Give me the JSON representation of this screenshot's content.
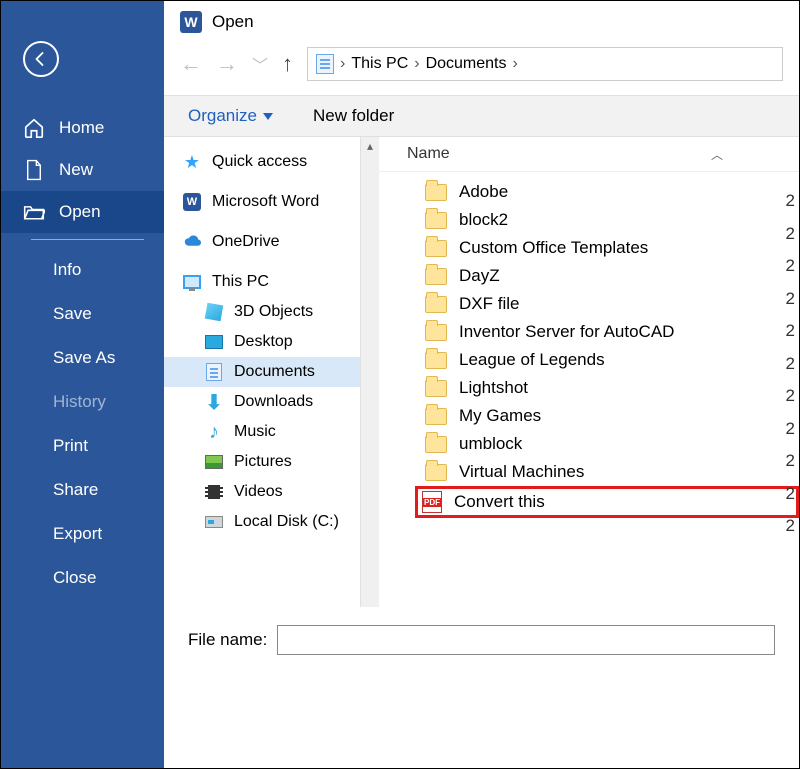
{
  "word_sidebar": {
    "back_label": "Back",
    "primary": [
      {
        "icon": "home",
        "label": "Home"
      },
      {
        "icon": "new",
        "label": "New"
      },
      {
        "icon": "open",
        "label": "Open",
        "selected": true
      }
    ],
    "secondary": [
      {
        "label": "Info"
      },
      {
        "label": "Save"
      },
      {
        "label": "Save As"
      },
      {
        "label": "History",
        "dim": true
      },
      {
        "label": "Print"
      },
      {
        "label": "Share"
      },
      {
        "label": "Export"
      },
      {
        "label": "Close"
      }
    ]
  },
  "dialog": {
    "title": "Open",
    "breadcrumb": [
      "This PC",
      "Documents"
    ],
    "toolbar": {
      "organize": "Organize",
      "newfolder": "New folder"
    },
    "nav_items": [
      {
        "type": "quickaccess",
        "label": "Quick access"
      },
      {
        "type": "word",
        "label": "Microsoft Word"
      },
      {
        "type": "onedrive",
        "label": "OneDrive"
      },
      {
        "type": "thispc",
        "label": "This PC"
      },
      {
        "type": "3dobjects",
        "label": "3D Objects",
        "child": true
      },
      {
        "type": "desktop",
        "label": "Desktop",
        "child": true
      },
      {
        "type": "documents",
        "label": "Documents",
        "child": true,
        "selected": true
      },
      {
        "type": "downloads",
        "label": "Downloads",
        "child": true
      },
      {
        "type": "music",
        "label": "Music",
        "child": true
      },
      {
        "type": "pictures",
        "label": "Pictures",
        "child": true
      },
      {
        "type": "videos",
        "label": "Videos",
        "child": true
      },
      {
        "type": "disk",
        "label": "Local Disk (C:)",
        "child": true
      }
    ],
    "column_header": "Name",
    "files": [
      {
        "kind": "folder",
        "name": "Adobe"
      },
      {
        "kind": "folder",
        "name": "block2"
      },
      {
        "kind": "folder",
        "name": "Custom Office Templates"
      },
      {
        "kind": "folder",
        "name": "DayZ"
      },
      {
        "kind": "folder",
        "name": "DXF file"
      },
      {
        "kind": "folder",
        "name": "Inventor Server for AutoCAD"
      },
      {
        "kind": "folder",
        "name": "League of Legends"
      },
      {
        "kind": "folder",
        "name": "Lightshot"
      },
      {
        "kind": "folder",
        "name": "My Games"
      },
      {
        "kind": "folder",
        "name": "umblock"
      },
      {
        "kind": "folder",
        "name": "Virtual Machines"
      },
      {
        "kind": "pdf",
        "name": "Convert this",
        "highlight": true
      }
    ],
    "date_column_hint": [
      "2",
      "2",
      "2",
      "2",
      "2",
      "2",
      "2",
      "2",
      "2",
      "2",
      "2"
    ],
    "filename_label": "File name:",
    "filename_value": ""
  }
}
